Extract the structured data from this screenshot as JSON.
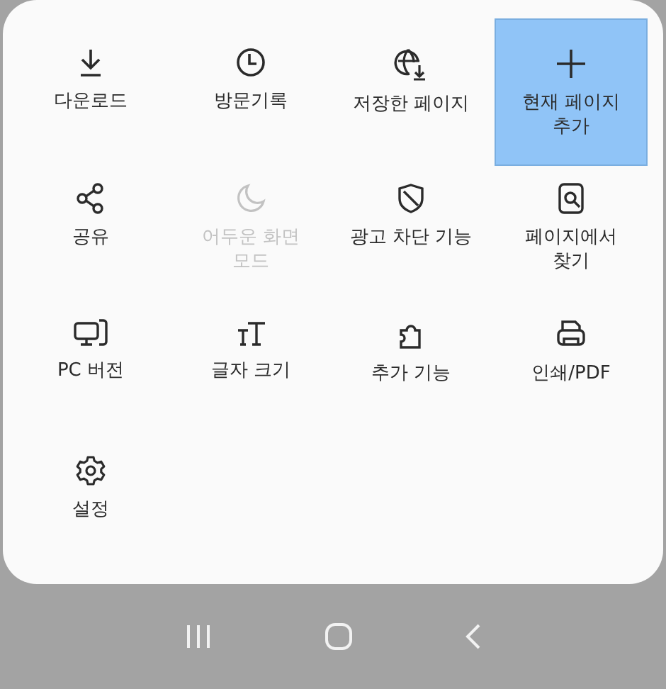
{
  "menu": {
    "items": [
      {
        "label": "다운로드",
        "selected": false,
        "disabled": false
      },
      {
        "label": "방문기록",
        "selected": false,
        "disabled": false
      },
      {
        "label": "저장한 페이지",
        "selected": false,
        "disabled": false
      },
      {
        "label": "현재 페이지\n추가",
        "selected": true,
        "disabled": false
      },
      {
        "label": "공유",
        "selected": false,
        "disabled": false
      },
      {
        "label": "어두운 화면\n모드",
        "selected": false,
        "disabled": true
      },
      {
        "label": "광고 차단 기능",
        "selected": false,
        "disabled": false
      },
      {
        "label": "페이지에서\n찾기",
        "selected": false,
        "disabled": false
      },
      {
        "label": "PC 버전",
        "selected": false,
        "disabled": false
      },
      {
        "label": "글자 크기",
        "selected": false,
        "disabled": false
      },
      {
        "label": "추가 기능",
        "selected": false,
        "disabled": false
      },
      {
        "label": "인쇄/PDF",
        "selected": false,
        "disabled": false
      },
      {
        "label": "설정",
        "selected": false,
        "disabled": false
      }
    ]
  }
}
